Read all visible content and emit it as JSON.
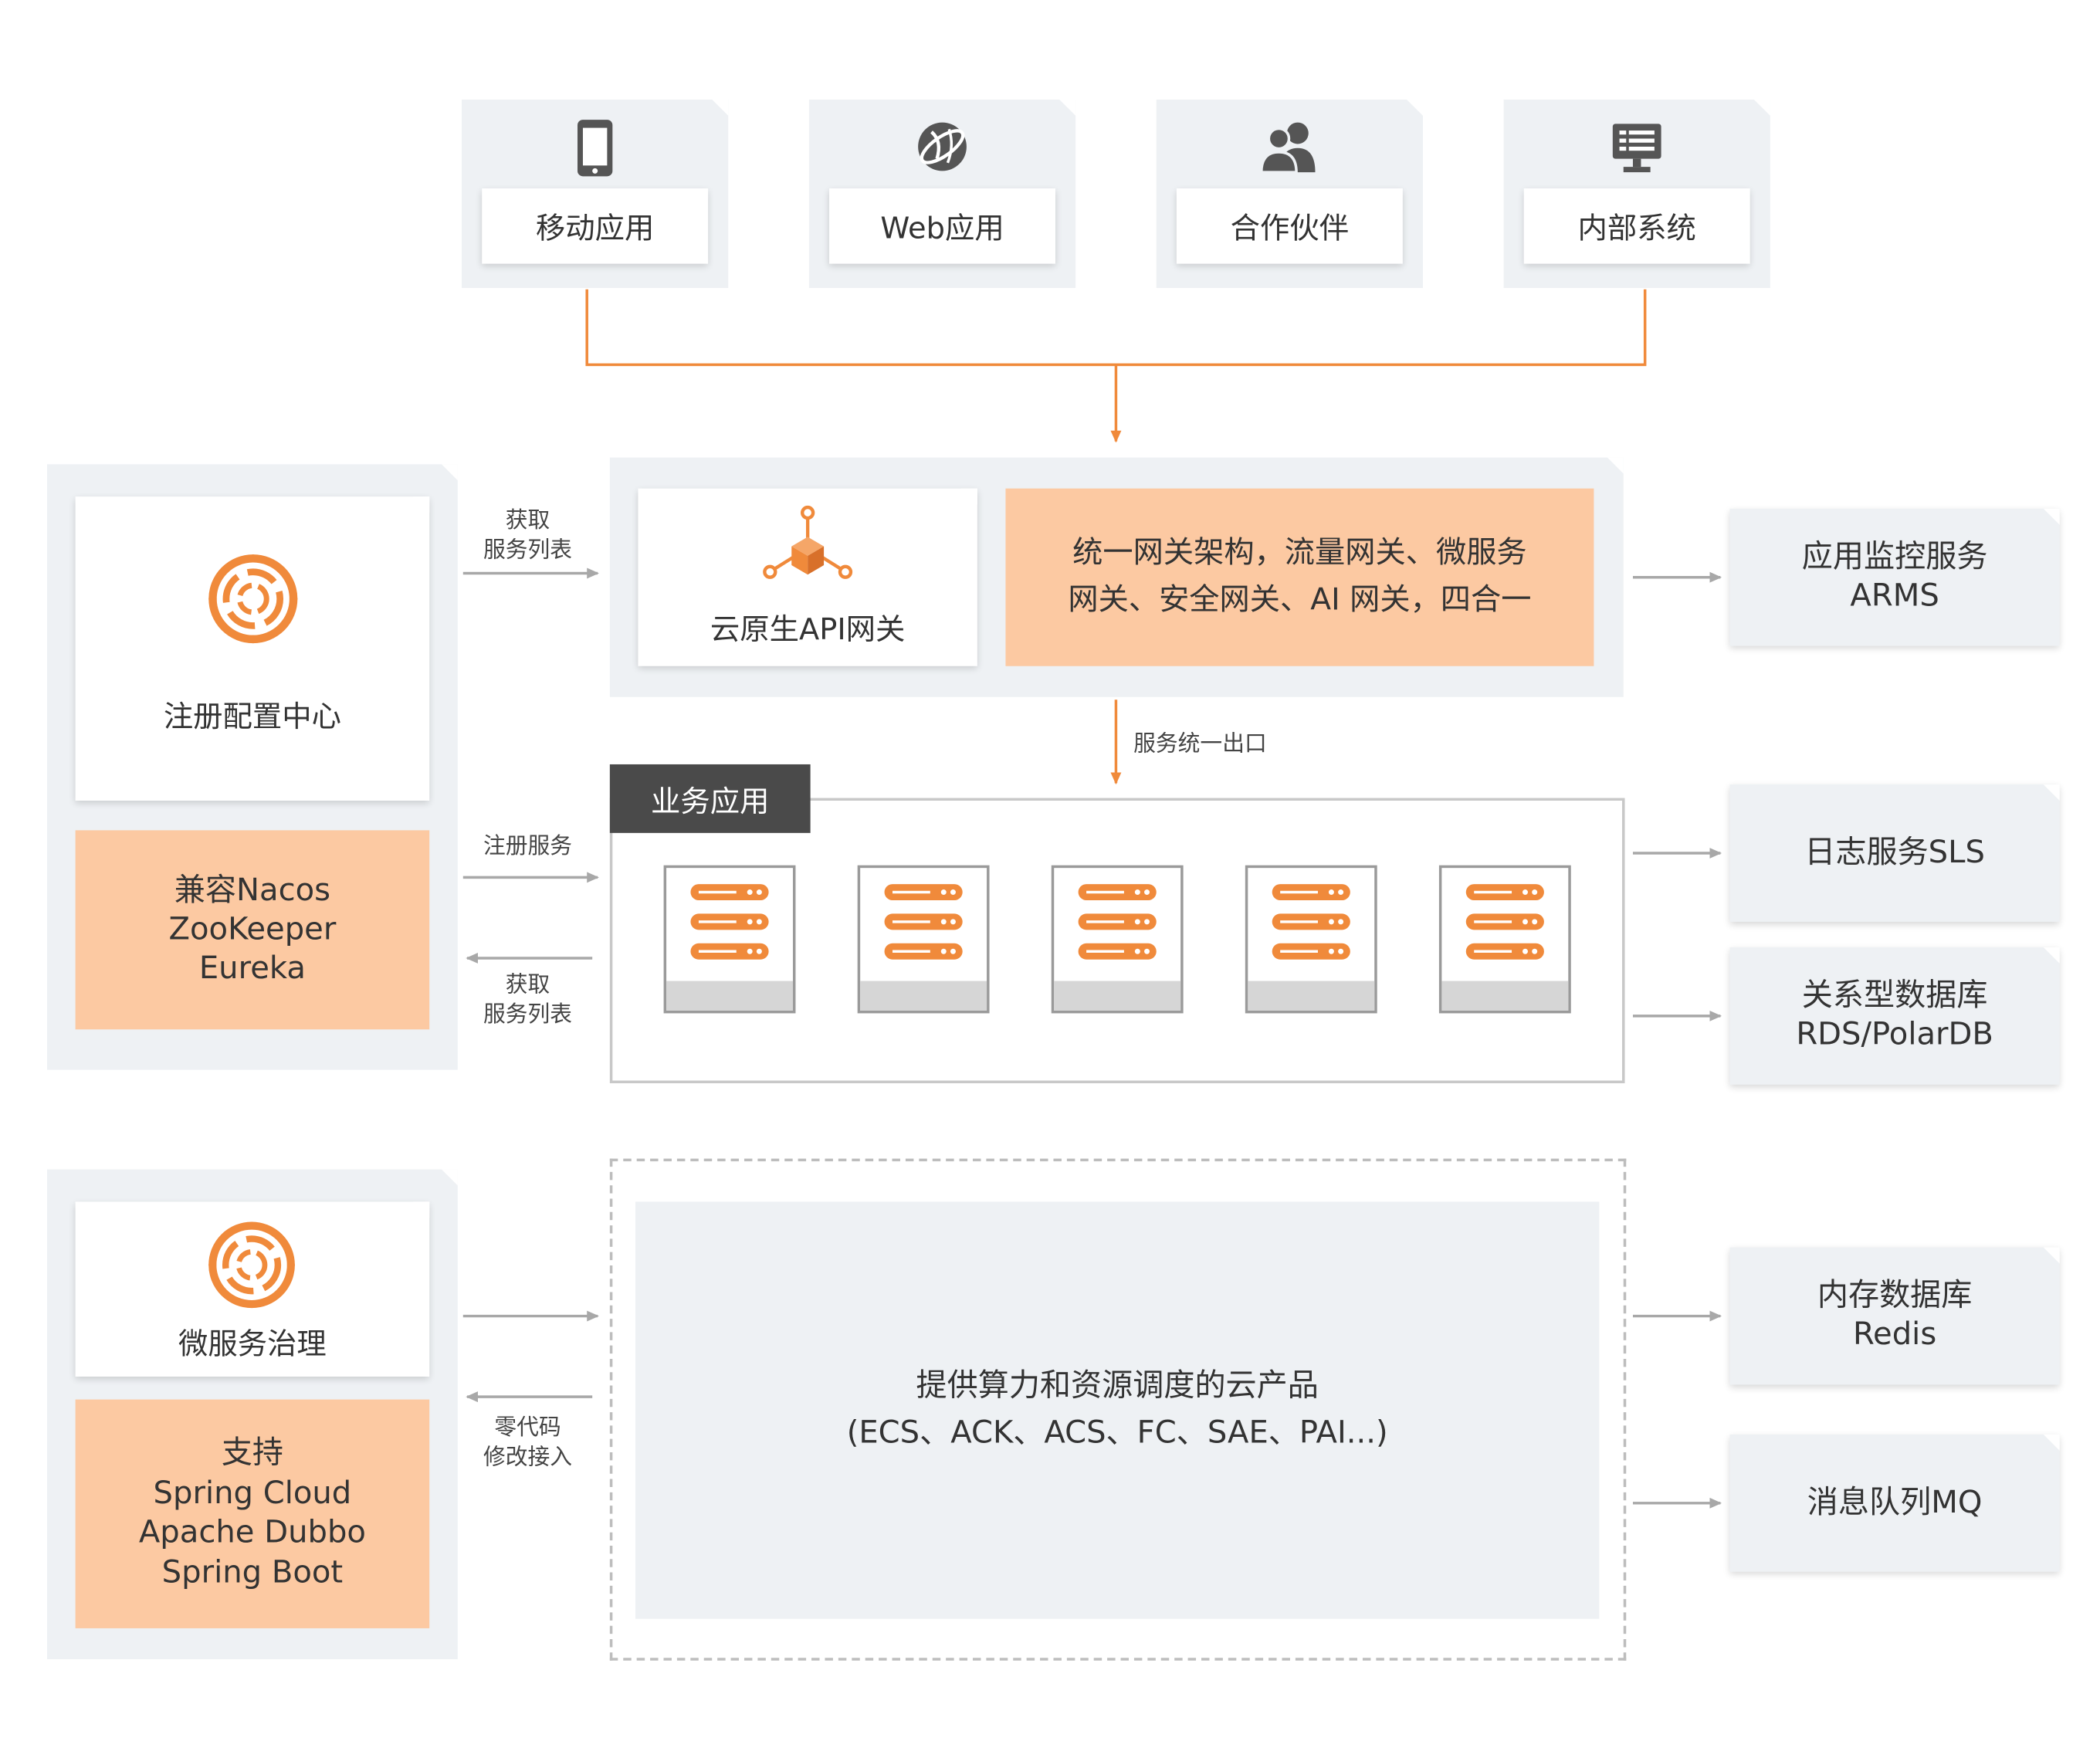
{
  "colors": {
    "orange": "#f08a3b",
    "orange_fill": "#fcc9a2",
    "panel_grey": "#eef1f4",
    "arrow_grey": "#a8a8a8",
    "dark_tab": "#4a4a4a"
  },
  "clients": [
    {
      "label": "移动应用",
      "icon": "mobile-phone-icon"
    },
    {
      "label": "Web应用",
      "icon": "globe-icon"
    },
    {
      "label": "合作伙伴",
      "icon": "people-icon"
    },
    {
      "label": "内部系统",
      "icon": "monitor-icon"
    }
  ],
  "registry": {
    "title": "注册配置中心",
    "compat_lines": [
      "兼容Nacos",
      "ZooKeeper",
      "Eureka"
    ]
  },
  "gateway": {
    "title": "云原生API网关",
    "desc_lines": [
      "统一网关架构，流量网关、微服务",
      "网关、安全网关、AI 网关，四合一"
    ]
  },
  "edge_labels": {
    "get_list_top": [
      "获取",
      "服务列表"
    ],
    "register": "注册服务",
    "get_list_mid": [
      "获取",
      "服务列表"
    ],
    "zero_code": [
      "零代码",
      "修改接入"
    ],
    "unified_exit": "服务统一出口"
  },
  "business": {
    "tab": "业务应用",
    "server_count": 5
  },
  "governance": {
    "title": "微服务治理",
    "support_lines": [
      "支持",
      "Spring Cloud",
      "Apache Dubbo",
      "Spring Boot"
    ]
  },
  "compute": {
    "lines": [
      "提供算力和资源调度的云产品",
      "(ECS、ACK、ACS、FC、SAE、PAI...)"
    ]
  },
  "services": [
    {
      "lines": [
        "应用监控服务",
        "ARMS"
      ]
    },
    {
      "lines": [
        "日志服务SLS"
      ]
    },
    {
      "lines": [
        "关系型数据库",
        "RDS/PolarDB"
      ]
    },
    {
      "lines": [
        "内存数据库",
        "Redis"
      ]
    },
    {
      "lines": [
        "消息队列MQ"
      ]
    }
  ]
}
